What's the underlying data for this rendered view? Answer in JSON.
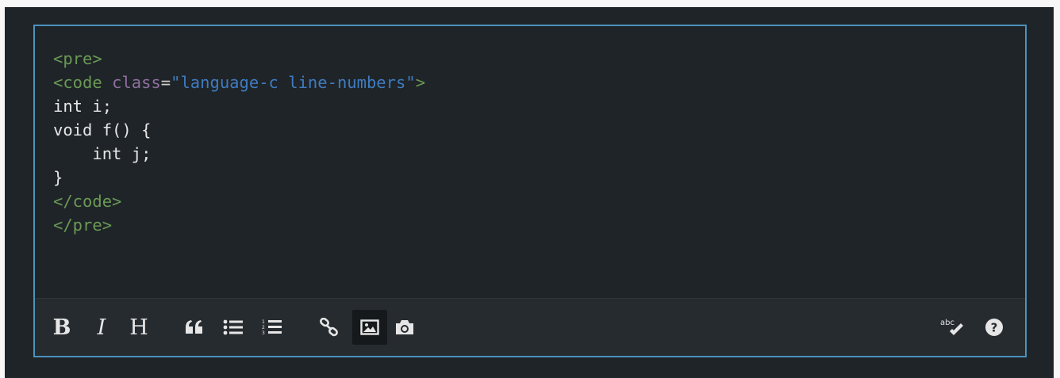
{
  "editor": {
    "code_lines": [
      {
        "segments": [
          {
            "cls": "tag",
            "text": "<pre>"
          }
        ]
      },
      {
        "segments": [
          {
            "cls": "tag",
            "text": "<code "
          },
          {
            "cls": "attr",
            "text": "class"
          },
          {
            "cls": "punct",
            "text": "="
          },
          {
            "cls": "str",
            "text": "\"language-c line-numbers\""
          },
          {
            "cls": "tag",
            "text": ">"
          }
        ]
      },
      {
        "segments": [
          {
            "cls": "plain",
            "text": "int i;"
          }
        ]
      },
      {
        "segments": [
          {
            "cls": "plain",
            "text": "void f() {"
          }
        ]
      },
      {
        "segments": [
          {
            "cls": "plain",
            "text": "    int j;"
          }
        ]
      },
      {
        "segments": [
          {
            "cls": "plain",
            "text": "}"
          }
        ]
      },
      {
        "segments": [
          {
            "cls": "tag",
            "text": "</code>"
          }
        ]
      },
      {
        "segments": [
          {
            "cls": "tag",
            "text": "</pre>"
          }
        ]
      }
    ]
  },
  "toolbar": {
    "bold_label": "B",
    "italic_label": "I",
    "heading_label": "H",
    "active_button": "image",
    "icons": {
      "quote": "quote-icon",
      "bullet_list": "unordered-list-icon",
      "numbered_list": "ordered-list-icon",
      "link": "link-icon",
      "image": "image-icon",
      "camera": "camera-icon",
      "spellcheck": "spellcheck-icon",
      "help": "help-icon"
    },
    "spellcheck_text": "abc",
    "help_glyph": "?"
  },
  "colors": {
    "background": "#1f2428",
    "border_accent": "#4c92bd",
    "toolbar_bg": "#262b2f",
    "tag": "#6a9955",
    "attribute": "#8f6f9f",
    "string": "#3f7bbf",
    "text": "#e6e6e6"
  }
}
